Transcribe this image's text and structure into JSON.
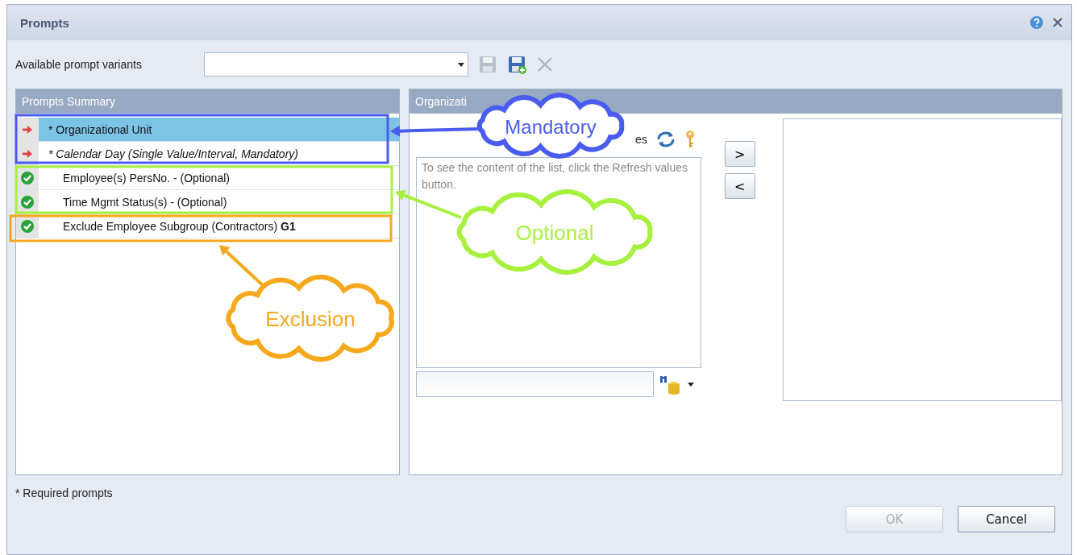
{
  "window": {
    "title": "Prompts"
  },
  "variants": {
    "label": "Available prompt variants"
  },
  "summary": {
    "title": "Prompts Summary",
    "rows": [
      {
        "text": "* Organizational Unit",
        "kind": "required",
        "selected": true,
        "emphasis": false
      },
      {
        "text": "* Calendar Day (Single Value/Interval, Mandatory)",
        "kind": "required",
        "selected": false,
        "emphasis": true
      },
      {
        "text": "Employee(s) PersNo. - (Optional)",
        "kind": "done",
        "selected": false,
        "emphasis": false
      },
      {
        "text": "Time Mgmt Status(s) - (Optional)",
        "kind": "done",
        "selected": false,
        "emphasis": false
      },
      {
        "text": "Exclude Employee Subgroup (Contractors) **G1**",
        "kind": "done",
        "selected": false,
        "emphasis": false
      }
    ]
  },
  "detail": {
    "title": "Organizati",
    "label_fragment": "es",
    "hint": "To see the content of the list, click the Refresh values button.",
    "buttons": [
      ">",
      "<"
    ]
  },
  "footnote": "* Required prompts",
  "buttons": [
    {
      "label": "OK",
      "disabled": true
    },
    {
      "label": "Cancel",
      "disabled": false
    }
  ],
  "callouts": [
    {
      "label": "Mandatory",
      "color": "#4a5cf0"
    },
    {
      "label": "Optional",
      "color": "#a6f03e"
    },
    {
      "label": "Exclusion",
      "color": "#f5a81c"
    }
  ]
}
